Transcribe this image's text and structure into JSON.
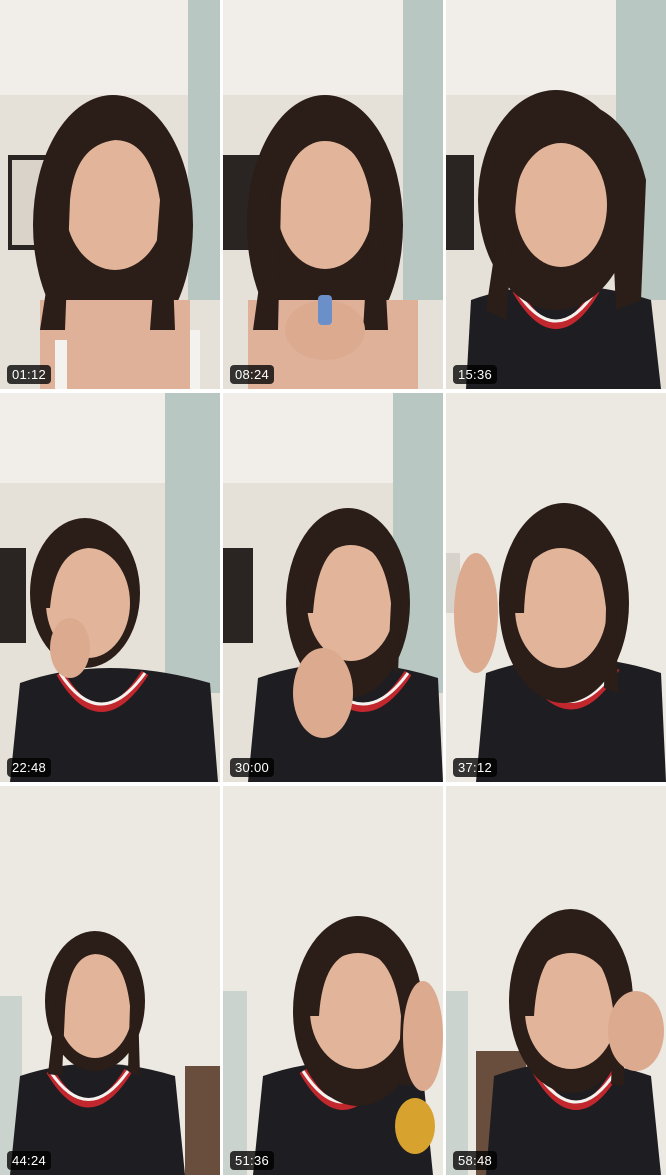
{
  "timestamps": [
    "01:12",
    "08:24",
    "15:36",
    "22:48",
    "30:00",
    "37:12",
    "44:24",
    "51:36",
    "58:48"
  ],
  "colors": {
    "overlay": "#000000",
    "jersey": "#1e1e22",
    "jersey_trim_red": "#c1272d",
    "hair": "#2b1d17",
    "skin": "#e2b49a",
    "wall": "#e9e4dd"
  }
}
